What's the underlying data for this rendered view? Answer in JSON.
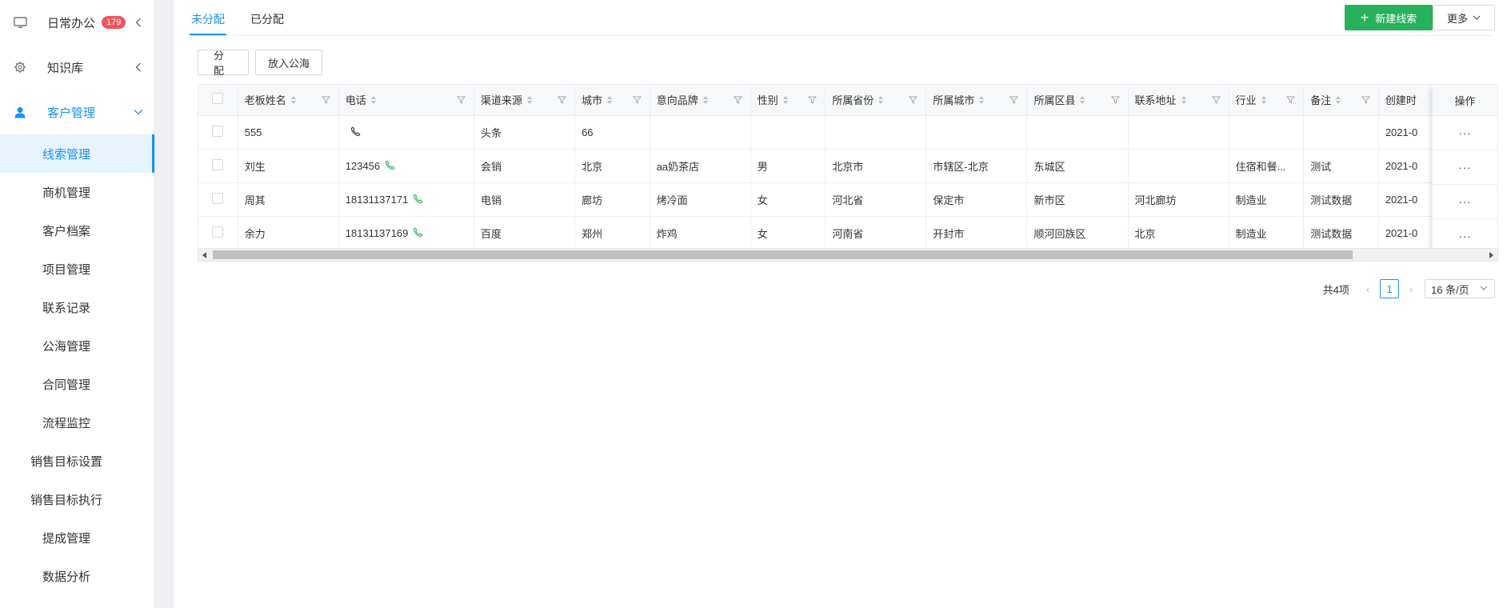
{
  "sidebar": {
    "groups": [
      {
        "label": "日常办公",
        "badge": "179",
        "icon": "monitor-icon"
      },
      {
        "label": "知识库",
        "icon": "gear-icon"
      },
      {
        "label": "客户管理",
        "icon": "user-icon"
      }
    ],
    "items": [
      {
        "label": "线索管理"
      },
      {
        "label": "商机管理"
      },
      {
        "label": "客户档案"
      },
      {
        "label": "项目管理"
      },
      {
        "label": "联系记录"
      },
      {
        "label": "公海管理"
      },
      {
        "label": "合同管理"
      },
      {
        "label": "流程监控"
      },
      {
        "label": "销售目标设置"
      },
      {
        "label": "销售目标执行"
      },
      {
        "label": "提成管理"
      },
      {
        "label": "数据分析"
      }
    ]
  },
  "tabs": [
    {
      "label": "未分配",
      "active": true
    },
    {
      "label": "已分配"
    }
  ],
  "header": {
    "new_label": "新建线索",
    "more_label": "更多"
  },
  "toolbar": {
    "assign_label": "分配",
    "pool_label": "放入公海"
  },
  "table": {
    "columns": [
      {
        "label": "老板姓名"
      },
      {
        "label": "电话"
      },
      {
        "label": "渠道来源"
      },
      {
        "label": "城市"
      },
      {
        "label": "意向品牌"
      },
      {
        "label": "性别"
      },
      {
        "label": "所属省份"
      },
      {
        "label": "所属城市"
      },
      {
        "label": "所属区县"
      },
      {
        "label": "联系地址"
      },
      {
        "label": "行业"
      },
      {
        "label": "备注"
      },
      {
        "label": "创建时"
      }
    ],
    "op_label": "操作",
    "op_more": "···",
    "rows": [
      {
        "name": "555",
        "phone": "",
        "source": "头条",
        "city": "66",
        "brand": "",
        "gender": "",
        "province": "",
        "pcity": "",
        "district": "",
        "address": "",
        "industry": "",
        "remark": "",
        "created": "2021-0"
      },
      {
        "name": "刘生",
        "phone": "123456",
        "source": "会销",
        "city": "北京",
        "brand": "aa奶茶店",
        "gender": "男",
        "province": "北京市",
        "pcity": "市辖区-北京",
        "district": "东城区",
        "address": "",
        "industry": "住宿和餐...",
        "remark": "测试",
        "created": "2021-0"
      },
      {
        "name": "周其",
        "phone": "18131137171",
        "source": "电销",
        "city": "廊坊",
        "brand": "烤冷面",
        "gender": "女",
        "province": "河北省",
        "pcity": "保定市",
        "district": "新市区",
        "address": "河北廊坊",
        "industry": "制造业",
        "remark": "测试数据",
        "created": "2021-0"
      },
      {
        "name": "余力",
        "phone": "18131137169",
        "source": "百度",
        "city": "郑州",
        "brand": "炸鸡",
        "gender": "女",
        "province": "河南省",
        "pcity": "开封市",
        "district": "顺河回族区",
        "address": "北京",
        "industry": "制造业",
        "remark": "测试数据",
        "created": "2021-0"
      }
    ]
  },
  "pagination": {
    "total": "共4项",
    "current": "1",
    "page_size": "16 条/页"
  },
  "colors": {
    "accent": "#1890ff",
    "success": "#26b25a",
    "badge": "#f5535c"
  }
}
